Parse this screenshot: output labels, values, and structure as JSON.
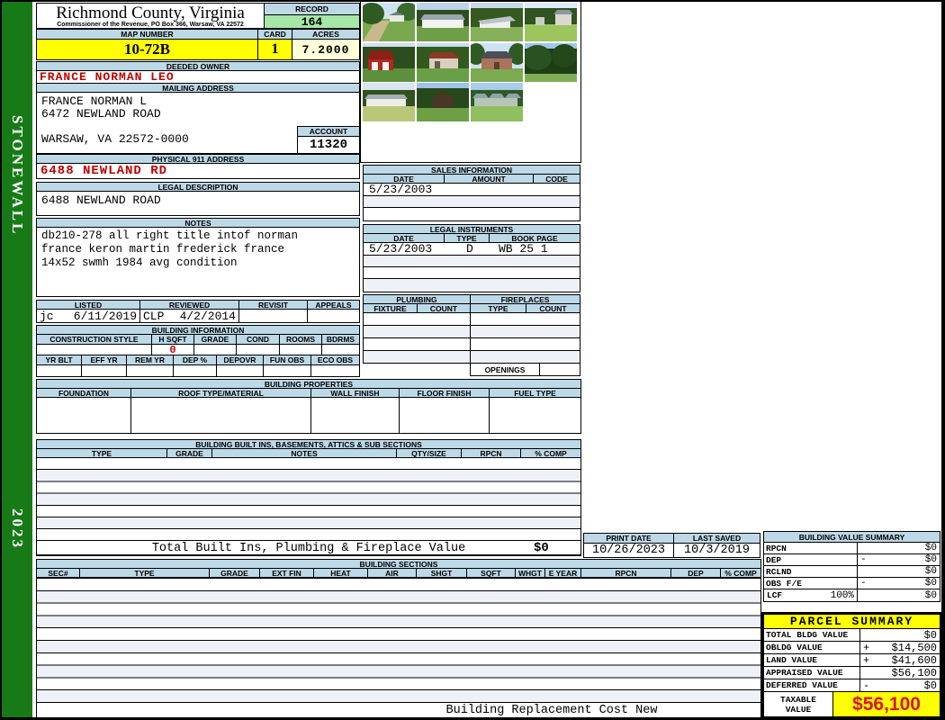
{
  "colors": {
    "header_blue": "#BDD8E7",
    "highlight_yellow": "#FFFF00",
    "record_green": "#A6E6A6",
    "acres_cream": "#FFFFD8",
    "alert_red": "#C00000",
    "taxable_red": "#DD1111",
    "sidebar_green": "#177A17"
  },
  "sidebar": {
    "district": "STONEWALL",
    "year": "2023"
  },
  "header": {
    "county_title": "Richmond County, Virginia",
    "county_subtitle": "Commissioner of the Revenue, PO Box 366, Warsaw, VA 22572",
    "record_label": "RECORD",
    "record_value": "164",
    "map_label": "MAP NUMBER",
    "map_value": "10-72B",
    "card_label": "CARD",
    "card_value": "1",
    "acres_label": "ACRES",
    "acres_value": "7.2000"
  },
  "owner": {
    "deeded_label": "DEEDED OWNER",
    "deeded_name": "FRANCE NORMAN LEO",
    "mailing_label": "MAILING ADDRESS",
    "line1": "FRANCE NORMAN L",
    "line2": "6472 NEWLAND ROAD",
    "line3": "WARSAW, VA 22572-0000",
    "account_label": "ACCOUNT",
    "account_value": "11320",
    "physical_label": "PHYSICAL 911 ADDRESS",
    "physical_value": "6488 NEWLAND RD",
    "legal_label": "LEGAL DESCRIPTION",
    "legal_value": "6488 NEWLAND ROAD"
  },
  "notes": {
    "label": "NOTES",
    "line1": "db210-278 all right title intof norman",
    "line2": "france keron martin frederick france",
    "line3": "14x52 swmh 1984 avg condition"
  },
  "review": {
    "listed_label": "LISTED",
    "listed_by": "jc",
    "listed_date": "6/11/2019",
    "reviewed_label": "REVIEWED",
    "reviewed_by": "CLP",
    "reviewed_date": "4/2/2014",
    "revisit_label": "REVISIT",
    "appeals_label": "APPEALS"
  },
  "building_information": {
    "title": "BUILDING INFORMATION",
    "cols1": [
      "CONSTRUCTION STYLE",
      "H SQFT",
      "GRADE",
      "COND",
      "ROOMS",
      "BDRMS"
    ],
    "h_sqft_value": "0",
    "cols2": [
      "YR BLT",
      "EFF YR",
      "REM YR",
      "DEP %",
      "DEPOVR",
      "FUN OBS",
      "ECO OBS"
    ]
  },
  "building_properties": {
    "title": "BUILDING PROPERTIES",
    "cols": [
      "FOUNDATION",
      "ROOF TYPE/MATERIAL",
      "WALL FINISH",
      "FLOOR FINISH",
      "FUEL TYPE"
    ]
  },
  "built_ins": {
    "title": "BUILDING BUILT INS, BASEMENTS, ATTICS & SUB SECTIONS",
    "cols": [
      "TYPE",
      "GRADE",
      "NOTES",
      "QTY/SIZE",
      "RPCN",
      "% COMP"
    ],
    "total_label": "Total Built Ins, Plumbing & Fireplace Value",
    "total_value": "$0"
  },
  "sales": {
    "title": "SALES INFORMATION",
    "cols": [
      "DATE",
      "AMOUNT",
      "CODE"
    ],
    "date_value": "5/23/2003"
  },
  "legal_instruments": {
    "title": "LEGAL INSTRUMENTS",
    "cols": [
      "DATE",
      "TYPE",
      "BOOK PAGE"
    ],
    "row": {
      "date": "5/23/2003",
      "type": "D",
      "bookpage": "WB 25 1"
    }
  },
  "plumbing": {
    "title": "PLUMBING",
    "cols": [
      "FIXTURE",
      "COUNT"
    ]
  },
  "fireplaces": {
    "title": "FIREPLACES",
    "cols": [
      "TYPE",
      "COUNT"
    ],
    "openings_label": "OPENINGS"
  },
  "print_info": {
    "print_label": "PRINT DATE",
    "print_value": "10/26/2023",
    "saved_label": "LAST SAVED",
    "saved_value": "10/3/2019"
  },
  "building_sections": {
    "title": "BUILDING SECTIONS",
    "cols": [
      "SEC#",
      "TYPE",
      "GRADE",
      "EXT FIN",
      "HEAT",
      "AIR",
      "SHGT",
      "SQFT",
      "WHGT",
      "E YEAR",
      "RPCN",
      "DEP",
      "% COMP"
    ],
    "footer": "Building Replacement Cost New"
  },
  "building_value_summary": {
    "title": "BUILDING VALUE SUMMARY",
    "rows": [
      {
        "label": "RPCN",
        "op": "",
        "value": "$0"
      },
      {
        "label": "DEP",
        "op": "-",
        "value": "$0"
      },
      {
        "label": "RCLND",
        "op": "",
        "value": "$0"
      },
      {
        "label": "OBS F/E",
        "op": "-",
        "value": "$0"
      },
      {
        "label": "LCF",
        "pct": "100%",
        "op": "",
        "value": "$0"
      }
    ]
  },
  "parcel_summary": {
    "title": "PARCEL SUMMARY",
    "rows": [
      {
        "label": "TOTAL BLDG VALUE",
        "op": "",
        "value": "$0"
      },
      {
        "label": "OBLDG VALUE",
        "op": "+",
        "value": "$14,500"
      },
      {
        "label": "LAND VALUE",
        "op": "+",
        "value": "$41,600"
      },
      {
        "label": "APPRAISED VALUE",
        "op": "",
        "value": "$56,100"
      },
      {
        "label": "DEFERRED VALUE",
        "op": "-",
        "value": "$0"
      }
    ],
    "taxable_label": "TAXABLE VALUE",
    "taxable_value": "$56,100"
  }
}
